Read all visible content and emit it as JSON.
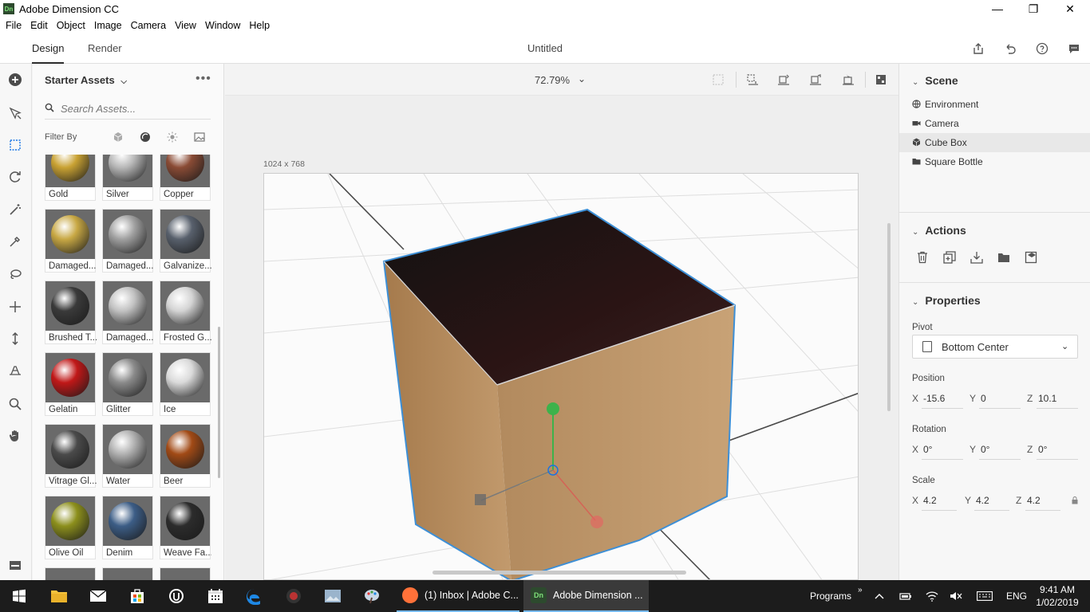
{
  "window": {
    "app_icon": "Dn",
    "title": "Adobe Dimension CC",
    "minimize": "—",
    "restore": "❐",
    "close": "✕"
  },
  "menu": [
    "File",
    "Edit",
    "Object",
    "Image",
    "Camera",
    "View",
    "Window",
    "Help"
  ],
  "header": {
    "tabs": [
      "Design",
      "Render"
    ],
    "active_tab": "Design",
    "doc_title": "Untitled"
  },
  "assets": {
    "title": "Starter Assets",
    "more": "•••",
    "search_placeholder": "Search Assets...",
    "filter_label": "Filter By",
    "items": [
      {
        "label": "Gold",
        "color": "#c9a233"
      },
      {
        "label": "Silver",
        "color": "#b8b8b8"
      },
      {
        "label": "Copper",
        "color": "#8a4b35"
      },
      {
        "label": "Damaged...",
        "color": "#c8a844"
      },
      {
        "label": "Damaged...",
        "color": "#a0a0a0"
      },
      {
        "label": "Galvanize...",
        "color": "#58606c"
      },
      {
        "label": "Brushed T...",
        "color": "#3a3a3a"
      },
      {
        "label": "Damaged...",
        "color": "#c2c2c2"
      },
      {
        "label": "Frosted G...",
        "color": "#d4d4d4"
      },
      {
        "label": "Gelatin",
        "color": "#c01818"
      },
      {
        "label": "Glitter",
        "color": "#8a8a8a"
      },
      {
        "label": "Ice",
        "color": "#dadada"
      },
      {
        "label": "Vitrage Gl...",
        "color": "#4a4a4a"
      },
      {
        "label": "Water",
        "color": "#b0b0b0"
      },
      {
        "label": "Beer",
        "color": "#a14a16"
      },
      {
        "label": "Olive Oil",
        "color": "#8c8f1c"
      },
      {
        "label": "Denim",
        "color": "#3c5d86"
      },
      {
        "label": "Weave Fa...",
        "color": "#2c2c2c"
      }
    ]
  },
  "viewport": {
    "zoom": "72.79%",
    "canvas_size": "1024 x 768"
  },
  "scene": {
    "title": "Scene",
    "items": [
      {
        "label": "Environment",
        "icon": "globe-icon",
        "selected": false
      },
      {
        "label": "Camera",
        "icon": "camera-icon",
        "selected": false
      },
      {
        "label": "Cube Box",
        "icon": "cube-icon",
        "selected": true
      },
      {
        "label": "Square Bottle",
        "icon": "folder-icon",
        "selected": false
      }
    ]
  },
  "actions": {
    "title": "Actions"
  },
  "properties": {
    "title": "Properties",
    "pivot_label": "Pivot",
    "pivot_value": "Bottom Center",
    "position_label": "Position",
    "position": {
      "x": "-15.6",
      "y": "0",
      "z": "10.1"
    },
    "rotation_label": "Rotation",
    "rotation": {
      "x": "0°",
      "y": "0°",
      "z": "0°"
    },
    "scale_label": "Scale",
    "scale": {
      "x": "4.2",
      "y": "4.2",
      "z": "4.2"
    }
  },
  "taskbar": {
    "tasks": [
      {
        "label": "(1) Inbox | Adobe C...",
        "icon_color": "#ff7139"
      },
      {
        "label": "Adobe Dimension ...",
        "icon_color": "#2d4a2e"
      }
    ],
    "programs": "Programs",
    "language": "ENG",
    "time": "9:41 AM",
    "date": "1/02/2019"
  },
  "colors": {
    "accent": "#1473e6",
    "selection_outline": "#3d8fd6"
  }
}
